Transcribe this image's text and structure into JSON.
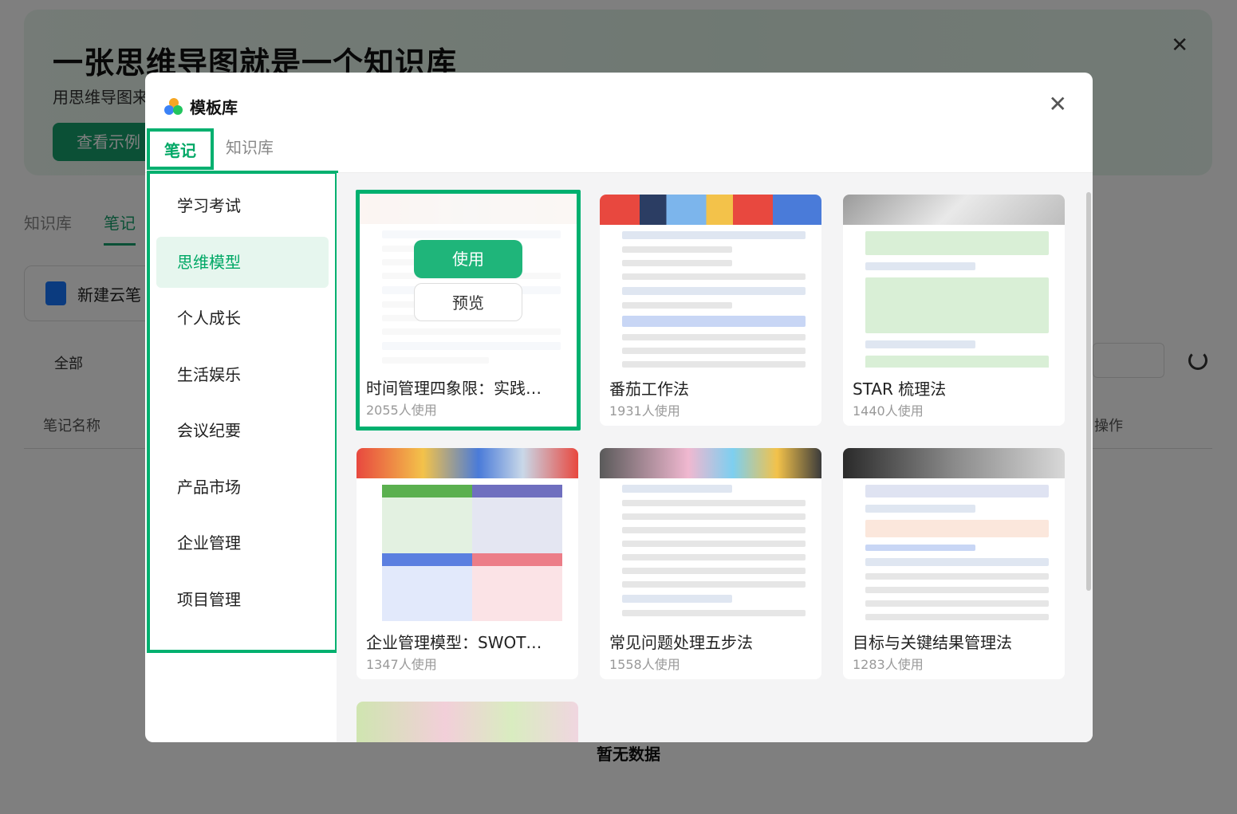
{
  "background": {
    "banner_title": "一张思维导图就是一个知识库",
    "banner_subtitle": "用思维导图来",
    "banner_button": "查看示例",
    "tabs": [
      "知识库",
      "笔记"
    ],
    "new_button": "新建云笔",
    "filter_all": "全部",
    "col_name": "笔记名称",
    "col_op": "操作",
    "empty": "暂无数据"
  },
  "modal": {
    "title": "模板库",
    "close_icon": "close-icon",
    "tabs": [
      {
        "label": "笔记",
        "active": true
      },
      {
        "label": "知识库",
        "active": false
      }
    ],
    "categories": [
      {
        "label": "学习考试",
        "active": false
      },
      {
        "label": "思维模型",
        "active": true
      },
      {
        "label": "个人成长",
        "active": false
      },
      {
        "label": "生活娱乐",
        "active": false
      },
      {
        "label": "会议纪要",
        "active": false
      },
      {
        "label": "产品市场",
        "active": false
      },
      {
        "label": "企业管理",
        "active": false
      },
      {
        "label": "项目管理",
        "active": false
      }
    ],
    "hover_actions": {
      "use": "使用",
      "preview": "预览"
    },
    "templates": [
      {
        "name": "时间管理四象限：实践…",
        "uses": "2055人使用"
      },
      {
        "name": "番茄工作法",
        "uses": "1931人使用"
      },
      {
        "name": "STAR 梳理法",
        "uses": "1440人使用"
      },
      {
        "name": "企业管理模型：SWOT…",
        "uses": "1347人使用"
      },
      {
        "name": "常见问题处理五步法",
        "uses": "1558人使用"
      },
      {
        "name": "目标与关键结果管理法",
        "uses": "1283人使用"
      }
    ],
    "colors": {
      "accent": "#00a866",
      "highlight": "#00b06f"
    }
  }
}
